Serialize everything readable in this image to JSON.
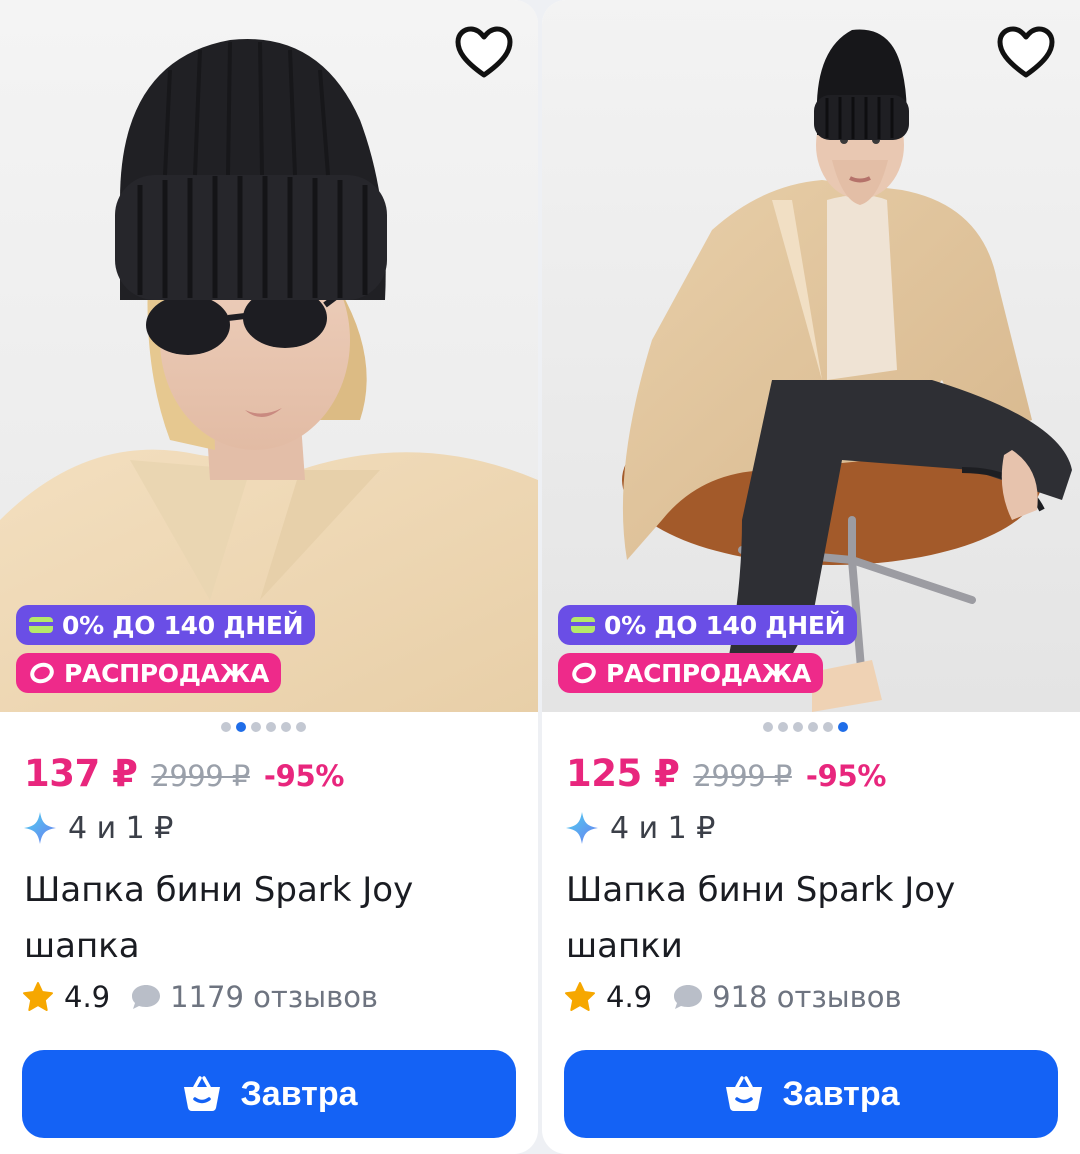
{
  "products": [
    {
      "badge_installment": "0% ДО 140 ДНЕЙ",
      "badge_sale": "РАСПРОДАЖА",
      "price": "137 ₽",
      "old_price": "2999 ₽",
      "discount": "-95%",
      "split_payment": "4 и 1 ₽",
      "title": "Шапка бини Spark Joy шапка",
      "rating": "4.9",
      "reviews": "1179 отзывов",
      "buy_label": "Завтра",
      "gallery_total": 6,
      "gallery_active": 2
    },
    {
      "badge_installment": "0% ДО 140 ДНЕЙ",
      "badge_sale": "РАСПРОДАЖА",
      "price": "125 ₽",
      "old_price": "2999 ₽",
      "discount": "-95%",
      "split_payment": "4 и 1 ₽",
      "title": "Шапка бини Spark Joy шапки",
      "rating": "4.9",
      "reviews": "918 отзывов",
      "buy_label": "Завтра",
      "gallery_total": 6,
      "gallery_active": 6
    }
  ],
  "icons": {
    "favorite": "heart-outline-icon",
    "installment": "card-icon",
    "sale": "ring-icon",
    "split": "sparkle-icon",
    "rating": "star-icon",
    "reviews": "comment-icon",
    "buy": "basket-icon"
  },
  "colors": {
    "price": "#e8267d",
    "buy_button": "#1462f5",
    "installment_badge": "#6a4ee6",
    "sale_badge": "#ee2a8a",
    "dot_active": "#1f6de8"
  }
}
